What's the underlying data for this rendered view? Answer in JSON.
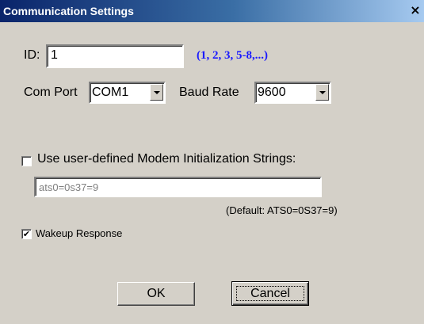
{
  "window": {
    "title": "Communication Settings",
    "close_glyph": "×"
  },
  "id_field": {
    "label": "ID:",
    "value": "1",
    "hint": "(1, 2, 3, 5-8,...)"
  },
  "com_port": {
    "label": "Com Port",
    "value": "COM1"
  },
  "baud_rate": {
    "label": "Baud Rate",
    "value": "9600"
  },
  "modem": {
    "checkbox_label": "Use user-defined Modem Initialization Strings:",
    "checked": false,
    "input_value": "ats0=0s37=9",
    "default_note": "(Default: ATS0=0S37=9)"
  },
  "wakeup": {
    "label": "Wakeup Response",
    "checked": true,
    "check_glyph": "✔"
  },
  "buttons": {
    "ok": "OK",
    "cancel": "Cancel"
  },
  "colors": {
    "hint": "#1a1aff",
    "dialog_bg": "#d4d0c8",
    "title_bg": "#0a246a"
  }
}
